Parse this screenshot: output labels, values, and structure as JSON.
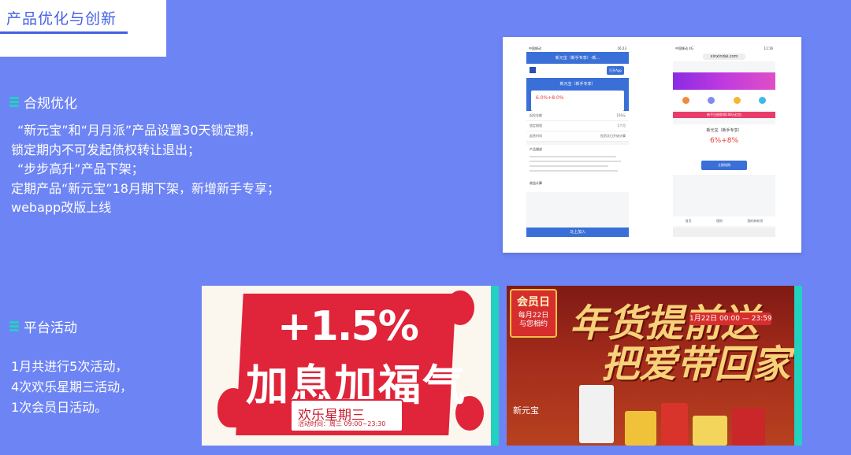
{
  "page": {
    "title": "产品优化与创新"
  },
  "sections": [
    {
      "heading": "合规优化",
      "lines": [
        "“新元宝”和“月月派”产品设置30天锁定期，",
        "锁定期内不可发起债权转让退出；",
        "“步步高升”产品下架；",
        "定期产品“新元宝”18月期下架，新增新手专享；",
        "webapp改版上线"
      ]
    },
    {
      "heading": "平台活动",
      "lines": [
        "1月共进行5次活动，",
        "4次欢乐星期三活动，",
        "1次会员日活动。"
      ]
    }
  ],
  "phones": {
    "left": {
      "status_carrier": "中国移动",
      "status_time": "16:23",
      "nav_title": "新元宝（新手专享）-新...",
      "open_app": "打开App",
      "hero_title": "新元宝（新手专享）",
      "rate": "6.0%+8.0%",
      "rows": [
        {
          "label": "起投金额",
          "value": "100元"
        },
        {
          "label": "锁定期限",
          "value": "1个月"
        },
        {
          "label": "起息时间",
          "value": "投资次日开始计算"
        }
      ],
      "section_desc": "产品描述",
      "section_calc": "收益计算",
      "bottom_button": "马上加入"
    },
    "right": {
      "status_carrier": "中国移动 4G",
      "status_time": "11:16",
      "url": "xinxindai.com",
      "strip_text": "新手注册即领108元红包",
      "product_name": "新元宝（新手专享）",
      "rate": "6%+8%",
      "buy_button": "立即抢购",
      "tabs": [
        "首页",
        "理财",
        "我的新新贷"
      ]
    }
  },
  "banners": {
    "left": {
      "rate": "+1.5%",
      "headline": "加息加福气",
      "weekday": "欢乐星期三",
      "time": "活动时间：周三 09:00~23:30"
    },
    "right": {
      "badge_title": "会员日",
      "badge_sub1": "每月22日",
      "badge_sub2": "与您相约",
      "headline1": "年货提前送",
      "headline2": "把爱带回家",
      "date_range": "1月22日 00:00 — 23:59",
      "product_tag": "新元宝"
    }
  },
  "colors": {
    "background": "#6d84f5",
    "accent": "#4360e6",
    "bullet": "#22d1c0"
  }
}
